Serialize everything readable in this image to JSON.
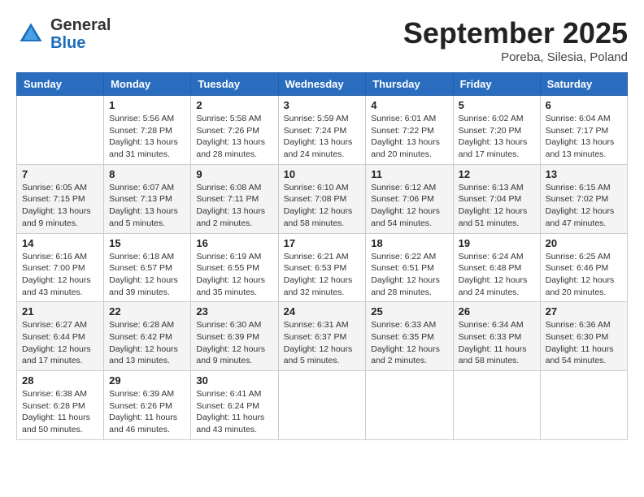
{
  "header": {
    "logo": {
      "general": "General",
      "blue": "Blue"
    },
    "month": "September 2025",
    "location": "Poreba, Silesia, Poland"
  },
  "weekdays": [
    "Sunday",
    "Monday",
    "Tuesday",
    "Wednesday",
    "Thursday",
    "Friday",
    "Saturday"
  ],
  "weeks": [
    [
      {
        "day": "",
        "info": ""
      },
      {
        "day": "1",
        "info": "Sunrise: 5:56 AM\nSunset: 7:28 PM\nDaylight: 13 hours\nand 31 minutes."
      },
      {
        "day": "2",
        "info": "Sunrise: 5:58 AM\nSunset: 7:26 PM\nDaylight: 13 hours\nand 28 minutes."
      },
      {
        "day": "3",
        "info": "Sunrise: 5:59 AM\nSunset: 7:24 PM\nDaylight: 13 hours\nand 24 minutes."
      },
      {
        "day": "4",
        "info": "Sunrise: 6:01 AM\nSunset: 7:22 PM\nDaylight: 13 hours\nand 20 minutes."
      },
      {
        "day": "5",
        "info": "Sunrise: 6:02 AM\nSunset: 7:20 PM\nDaylight: 13 hours\nand 17 minutes."
      },
      {
        "day": "6",
        "info": "Sunrise: 6:04 AM\nSunset: 7:17 PM\nDaylight: 13 hours\nand 13 minutes."
      }
    ],
    [
      {
        "day": "7",
        "info": "Sunrise: 6:05 AM\nSunset: 7:15 PM\nDaylight: 13 hours\nand 9 minutes."
      },
      {
        "day": "8",
        "info": "Sunrise: 6:07 AM\nSunset: 7:13 PM\nDaylight: 13 hours\nand 5 minutes."
      },
      {
        "day": "9",
        "info": "Sunrise: 6:08 AM\nSunset: 7:11 PM\nDaylight: 13 hours\nand 2 minutes."
      },
      {
        "day": "10",
        "info": "Sunrise: 6:10 AM\nSunset: 7:08 PM\nDaylight: 12 hours\nand 58 minutes."
      },
      {
        "day": "11",
        "info": "Sunrise: 6:12 AM\nSunset: 7:06 PM\nDaylight: 12 hours\nand 54 minutes."
      },
      {
        "day": "12",
        "info": "Sunrise: 6:13 AM\nSunset: 7:04 PM\nDaylight: 12 hours\nand 51 minutes."
      },
      {
        "day": "13",
        "info": "Sunrise: 6:15 AM\nSunset: 7:02 PM\nDaylight: 12 hours\nand 47 minutes."
      }
    ],
    [
      {
        "day": "14",
        "info": "Sunrise: 6:16 AM\nSunset: 7:00 PM\nDaylight: 12 hours\nand 43 minutes."
      },
      {
        "day": "15",
        "info": "Sunrise: 6:18 AM\nSunset: 6:57 PM\nDaylight: 12 hours\nand 39 minutes."
      },
      {
        "day": "16",
        "info": "Sunrise: 6:19 AM\nSunset: 6:55 PM\nDaylight: 12 hours\nand 35 minutes."
      },
      {
        "day": "17",
        "info": "Sunrise: 6:21 AM\nSunset: 6:53 PM\nDaylight: 12 hours\nand 32 minutes."
      },
      {
        "day": "18",
        "info": "Sunrise: 6:22 AM\nSunset: 6:51 PM\nDaylight: 12 hours\nand 28 minutes."
      },
      {
        "day": "19",
        "info": "Sunrise: 6:24 AM\nSunset: 6:48 PM\nDaylight: 12 hours\nand 24 minutes."
      },
      {
        "day": "20",
        "info": "Sunrise: 6:25 AM\nSunset: 6:46 PM\nDaylight: 12 hours\nand 20 minutes."
      }
    ],
    [
      {
        "day": "21",
        "info": "Sunrise: 6:27 AM\nSunset: 6:44 PM\nDaylight: 12 hours\nand 17 minutes."
      },
      {
        "day": "22",
        "info": "Sunrise: 6:28 AM\nSunset: 6:42 PM\nDaylight: 12 hours\nand 13 minutes."
      },
      {
        "day": "23",
        "info": "Sunrise: 6:30 AM\nSunset: 6:39 PM\nDaylight: 12 hours\nand 9 minutes."
      },
      {
        "day": "24",
        "info": "Sunrise: 6:31 AM\nSunset: 6:37 PM\nDaylight: 12 hours\nand 5 minutes."
      },
      {
        "day": "25",
        "info": "Sunrise: 6:33 AM\nSunset: 6:35 PM\nDaylight: 12 hours\nand 2 minutes."
      },
      {
        "day": "26",
        "info": "Sunrise: 6:34 AM\nSunset: 6:33 PM\nDaylight: 11 hours\nand 58 minutes."
      },
      {
        "day": "27",
        "info": "Sunrise: 6:36 AM\nSunset: 6:30 PM\nDaylight: 11 hours\nand 54 minutes."
      }
    ],
    [
      {
        "day": "28",
        "info": "Sunrise: 6:38 AM\nSunset: 6:28 PM\nDaylight: 11 hours\nand 50 minutes."
      },
      {
        "day": "29",
        "info": "Sunrise: 6:39 AM\nSunset: 6:26 PM\nDaylight: 11 hours\nand 46 minutes."
      },
      {
        "day": "30",
        "info": "Sunrise: 6:41 AM\nSunset: 6:24 PM\nDaylight: 11 hours\nand 43 minutes."
      },
      {
        "day": "",
        "info": ""
      },
      {
        "day": "",
        "info": ""
      },
      {
        "day": "",
        "info": ""
      },
      {
        "day": "",
        "info": ""
      }
    ]
  ]
}
